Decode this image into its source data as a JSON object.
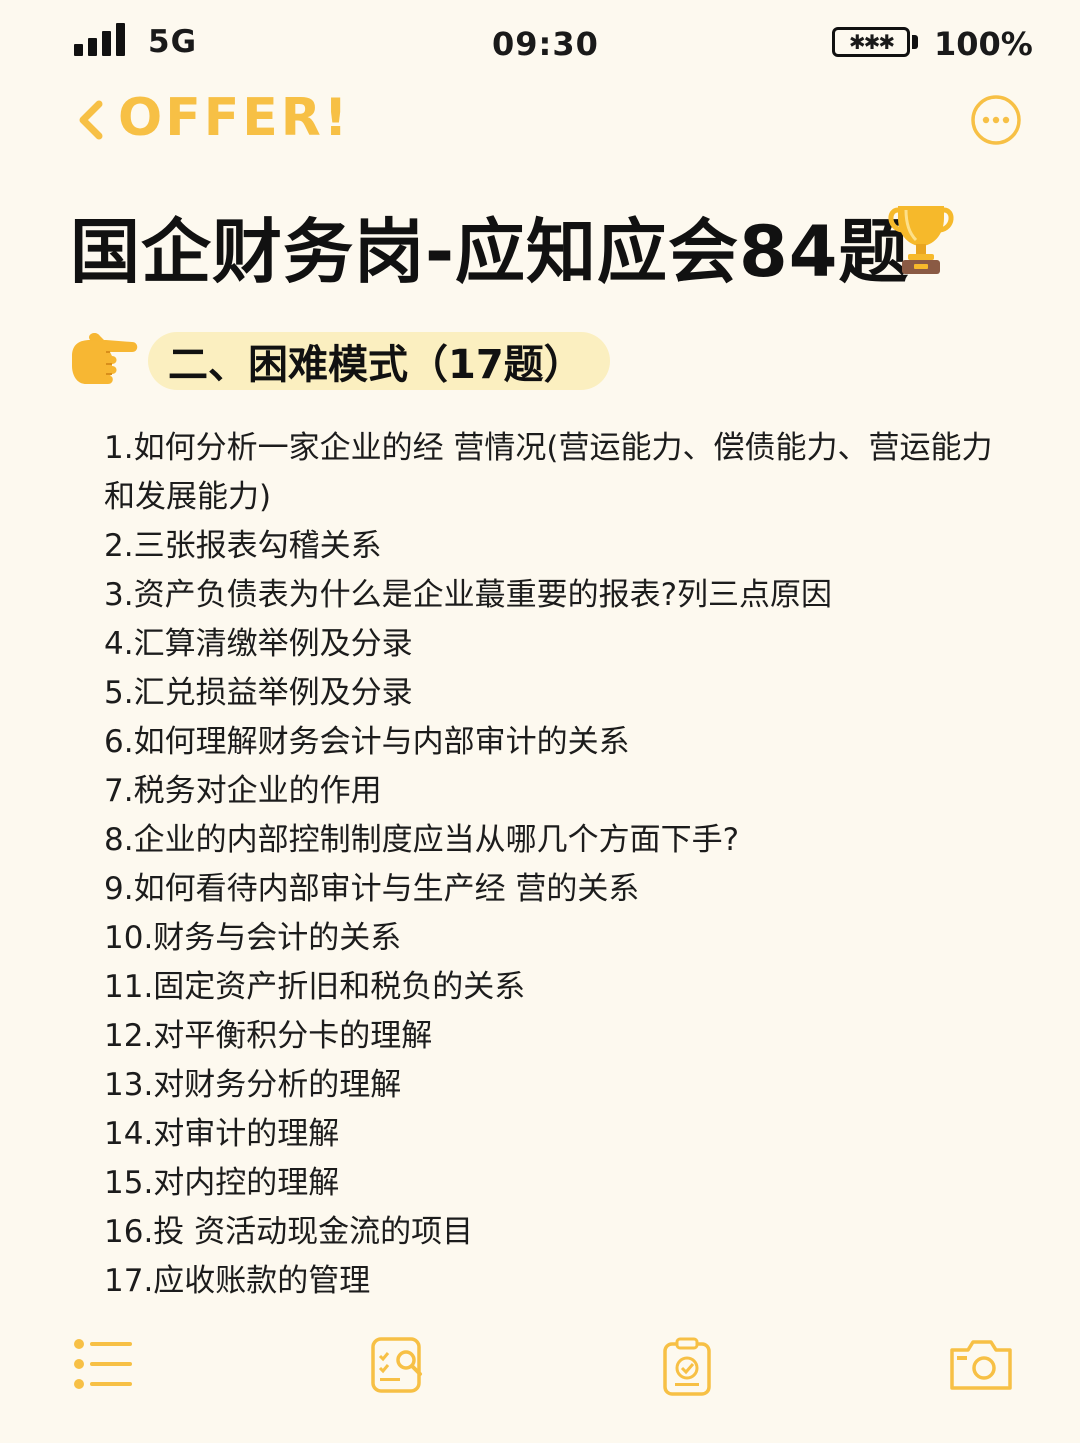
{
  "status_bar": {
    "network": "5G",
    "time": "09:30",
    "battery_text": "✱✱✱",
    "battery_percent": "100%",
    "icons": [
      "signal-icon",
      "battery-icon"
    ]
  },
  "nav": {
    "title": "OFFER!",
    "icons": [
      "back-chevron-icon",
      "more-options-icon"
    ],
    "accent_color": "#f7c045"
  },
  "headline": {
    "title": "国企财务岗-应知应会84题",
    "icon": "trophy-icon"
  },
  "section": {
    "label": "二、困难模式（17题）",
    "icon": "pointing-hand-icon",
    "pill_color": "#fbefc0"
  },
  "questions": [
    "1.如何分析一家企业的经 营情况(营运能力、偿债能力、营运能力和发展能力)",
    "2.三张报表勾稽关系",
    "3.资产负债表为什么是企业蕞重要的报表?列三点原因",
    "4.汇算清缴举例及分录",
    "5.汇兑损益举例及分录",
    "6.如何理解财务会计与内部审计的关系",
    "7.税务对企业的作用",
    "8.企业的内部控制制度应当从哪几个方面下手?",
    "9.如何看待内部审计与生产经 营的关系",
    "10.财务与会计的关系",
    "11.固定资产折旧和税负的关系",
    "12.对平衡积分卡的理解",
    "13.对财务分析的理解",
    "14.对审计的理解",
    "15.对内控的理解",
    "16.投 资活动现金流的项目",
    "17.应收账款的管理"
  ],
  "toolbar": {
    "icons": [
      "list-icon",
      "search-document-icon",
      "clipboard-check-icon",
      "camera-icon"
    ]
  }
}
